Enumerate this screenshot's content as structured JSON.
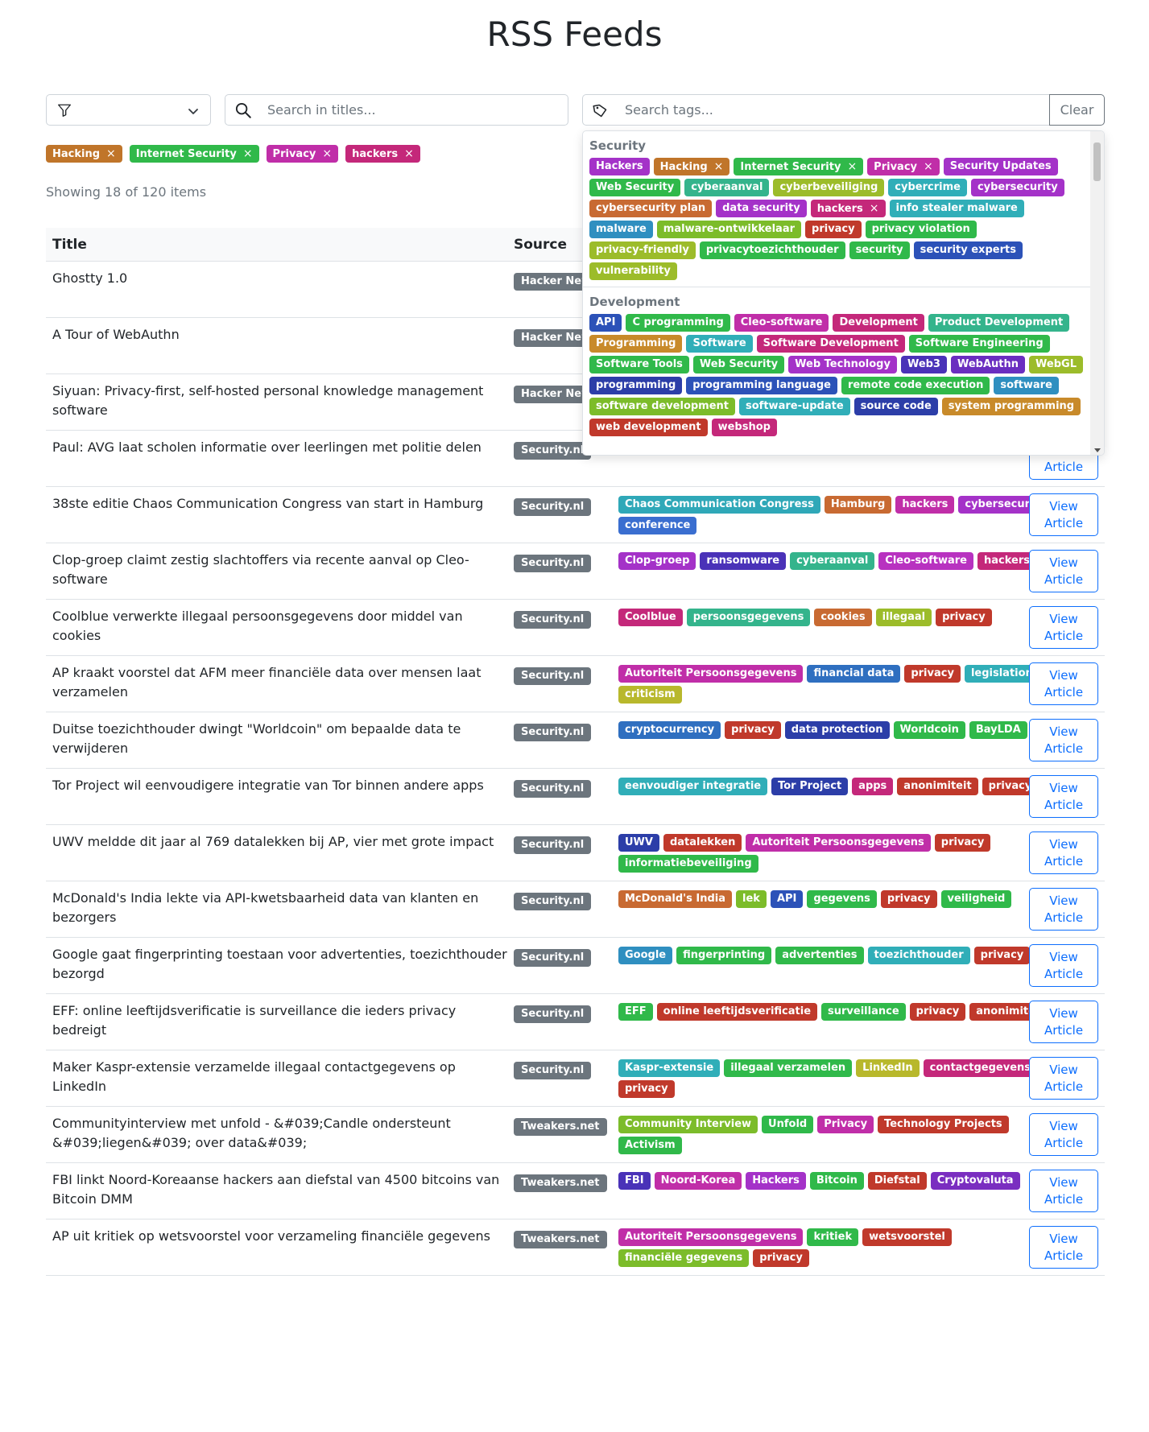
{
  "page": {
    "title": "RSS Feeds"
  },
  "filters": {
    "search_placeholder": "Search in titles...",
    "tag_search_placeholder": "Search tags...",
    "clear_label": "Clear",
    "active_tags": [
      {
        "label": "Hacking",
        "color": "#c0752a"
      },
      {
        "label": "Internet Security",
        "color": "#30b94a"
      },
      {
        "label": "Privacy",
        "color": "#c02ea8"
      },
      {
        "label": "hackers",
        "color": "#c4287a"
      }
    ],
    "remove_glyph": "×",
    "showing_text": "Showing 18 of 120 items"
  },
  "table": {
    "headers": {
      "title": "Title",
      "source": "Source"
    },
    "view_label": "View\nArticle",
    "rows": [
      {
        "title": "Ghostty 1.0",
        "source": "Hacker News",
        "tags": []
      },
      {
        "title": "A Tour of WebAuthn",
        "source": "Hacker News",
        "tags": []
      },
      {
        "title": "Siyuan: Privacy-first, self-hosted personal knowledge management software",
        "source": "Hacker News",
        "tags": []
      },
      {
        "title": "Paul: AVG laat scholen informatie over leerlingen met politie delen",
        "source": "Security.nl",
        "tags": []
      },
      {
        "title": "38ste editie Chaos Communication Congress van start in Hamburg",
        "source": "Security.nl",
        "tags": [
          {
            "label": "Chaos Communication Congress",
            "color": "#2fa8b8"
          },
          {
            "label": "Hamburg",
            "color": "#c86a32"
          },
          {
            "label": "hackers",
            "color": "#c02ea8"
          },
          {
            "label": "cybersecurity",
            "color": "#a432c8"
          },
          {
            "label": "conference",
            "color": "#3a6ed0"
          }
        ]
      },
      {
        "title": "Clop-groep claimt zestig slachtoffers via recente aanval op Cleo-software",
        "source": "Security.nl",
        "tags": [
          {
            "label": "Clop-groep",
            "color": "#a432c8"
          },
          {
            "label": "ransomware",
            "color": "#4a32b8"
          },
          {
            "label": "cyberaanval",
            "color": "#34b48c"
          },
          {
            "label": "Cleo-software",
            "color": "#b832c0"
          },
          {
            "label": "hackers",
            "color": "#c4287a"
          }
        ]
      },
      {
        "title": "Coolblue verwerkte illegaal persoonsgegevens door middel van cookies",
        "source": "Security.nl",
        "tags": [
          {
            "label": "Coolblue",
            "color": "#c4287a"
          },
          {
            "label": "persoonsgegevens",
            "color": "#34b48c"
          },
          {
            "label": "cookies",
            "color": "#c86a32"
          },
          {
            "label": "illegaal",
            "color": "#9cbc2a"
          },
          {
            "label": "privacy",
            "color": "#c0392b"
          }
        ]
      },
      {
        "title": "AP kraakt voorstel dat AFM meer financiële data over mensen laat verzamelen",
        "source": "Security.nl",
        "tags": [
          {
            "label": "Autoriteit Persoonsgegevens",
            "color": "#c02ea8"
          },
          {
            "label": "financial data",
            "color": "#2f6fc0"
          },
          {
            "label": "privacy",
            "color": "#c0392b"
          },
          {
            "label": "legislation",
            "color": "#30aeb8"
          },
          {
            "label": "criticism",
            "color": "#b8b82c"
          }
        ]
      },
      {
        "title": "Duitse toezichthouder dwingt \"Worldcoin\" om bepaalde data te verwijderen",
        "source": "Security.nl",
        "tags": [
          {
            "label": "cryptocurrency",
            "color": "#2f6fc0"
          },
          {
            "label": "privacy",
            "color": "#c0392b"
          },
          {
            "label": "data protection",
            "color": "#2c3ea8"
          },
          {
            "label": "Worldcoin",
            "color": "#30b94a"
          },
          {
            "label": "BayLDA",
            "color": "#30b94a"
          }
        ]
      },
      {
        "title": "Tor Project wil eenvoudigere integratie van Tor binnen andere apps",
        "source": "Security.nl",
        "tags": [
          {
            "label": "eenvoudiger integratie",
            "color": "#30aeb8"
          },
          {
            "label": "Tor Project",
            "color": "#2c3ea8"
          },
          {
            "label": "apps",
            "color": "#c4287a"
          },
          {
            "label": "anonimiteit",
            "color": "#c0392b"
          },
          {
            "label": "privacy",
            "color": "#c0392b"
          }
        ]
      },
      {
        "title": "UWV meldde dit jaar al 769 datalekken bij AP, vier met grote impact",
        "source": "Security.nl",
        "tags": [
          {
            "label": "UWV",
            "color": "#2c3ea8"
          },
          {
            "label": "datalekken",
            "color": "#c0392b"
          },
          {
            "label": "Autoriteit Persoonsgegevens",
            "color": "#c02ea8"
          },
          {
            "label": "privacy",
            "color": "#c0392b"
          },
          {
            "label": "informatiebeveiliging",
            "color": "#30b94a"
          }
        ]
      },
      {
        "title": "McDonald's India lekte via API-kwetsbaarheid data van klanten en bezorgers",
        "source": "Security.nl",
        "tags": [
          {
            "label": "McDonald's India",
            "color": "#c86a32"
          },
          {
            "label": "lek",
            "color": "#7cbc2a"
          },
          {
            "label": "API",
            "color": "#2c52b8"
          },
          {
            "label": "gegevens",
            "color": "#30b94a"
          },
          {
            "label": "privacy",
            "color": "#c0392b"
          },
          {
            "label": "veiligheid",
            "color": "#30b94a"
          }
        ]
      },
      {
        "title": "Google gaat fingerprinting toestaan voor advertenties, toezichthouder bezorgd",
        "source": "Security.nl",
        "tags": [
          {
            "label": "Google",
            "color": "#2f8fc0"
          },
          {
            "label": "fingerprinting",
            "color": "#30b94a"
          },
          {
            "label": "advertenties",
            "color": "#30b94a"
          },
          {
            "label": "toezichthouder",
            "color": "#30aeb8"
          },
          {
            "label": "privacy",
            "color": "#c0392b"
          }
        ]
      },
      {
        "title": "EFF: online leeftijdsverificatie is surveillance die ieders privacy bedreigt",
        "source": "Security.nl",
        "tags": [
          {
            "label": "EFF",
            "color": "#30b94a"
          },
          {
            "label": "online leeftijdsverificatie",
            "color": "#c0392b"
          },
          {
            "label": "surveillance",
            "color": "#30b94a"
          },
          {
            "label": "privacy",
            "color": "#c0392b"
          },
          {
            "label": "anonimiteit",
            "color": "#c0392b"
          }
        ]
      },
      {
        "title": "Maker Kaspr-extensie verzamelde illegaal contactgegevens op LinkedIn",
        "source": "Security.nl",
        "tags": [
          {
            "label": "Kaspr-extensie",
            "color": "#30aeb8"
          },
          {
            "label": "illegaal verzamelen",
            "color": "#30b94a"
          },
          {
            "label": "LinkedIn",
            "color": "#b8b82c"
          },
          {
            "label": "contactgegevens",
            "color": "#c4287a"
          },
          {
            "label": "privacy",
            "color": "#c0392b"
          }
        ]
      },
      {
        "title": "Communityinterview met unfold - &#039;Candle ondersteunt &#039;liegen&#039; over data&#039;",
        "source": "Tweakers.net",
        "tags": [
          {
            "label": "Community Interview",
            "color": "#7cbc2a"
          },
          {
            "label": "Unfold",
            "color": "#30b94a"
          },
          {
            "label": "Privacy",
            "color": "#c02ea8"
          },
          {
            "label": "Technology Projects",
            "color": "#c0392b"
          },
          {
            "label": "Activism",
            "color": "#30b94a"
          }
        ]
      },
      {
        "title": "FBI linkt Noord-Koreaanse hackers aan diefstal van 4500 bitcoins van Bitcoin DMM",
        "source": "Tweakers.net",
        "tags": [
          {
            "label": "FBI",
            "color": "#4a32b8"
          },
          {
            "label": "Noord-Korea",
            "color": "#c02ea8"
          },
          {
            "label": "Hackers",
            "color": "#a432c8"
          },
          {
            "label": "Bitcoin",
            "color": "#30b94a"
          },
          {
            "label": "Diefstal",
            "color": "#c0392b"
          },
          {
            "label": "Cryptovaluta",
            "color": "#7a2ec0"
          }
        ]
      },
      {
        "title": "AP uit kritiek op wetsvoorstel voor verzameling financiële gegevens",
        "source": "Tweakers.net",
        "tags": [
          {
            "label": "Autoriteit Persoonsgegevens",
            "color": "#c02ea8"
          },
          {
            "label": "kritiek",
            "color": "#30b94a"
          },
          {
            "label": "wetsvoorstel",
            "color": "#c0392b"
          },
          {
            "label": "financiële gegevens",
            "color": "#7cbc2a"
          },
          {
            "label": "privacy",
            "color": "#c0392b"
          }
        ]
      }
    ]
  },
  "dropdown": {
    "groups": [
      {
        "name": "Security",
        "tags": [
          {
            "label": "Hackers",
            "color": "#a432c8"
          },
          {
            "label": "Hacking",
            "color": "#c0752a",
            "selected": true
          },
          {
            "label": "Internet Security",
            "color": "#30b94a",
            "selected": true
          },
          {
            "label": "Privacy",
            "color": "#c02ea8",
            "selected": true
          },
          {
            "label": "Security Updates",
            "color": "#a432c8"
          },
          {
            "label": "Web Security",
            "color": "#30b94a"
          },
          {
            "label": "cyberaanval",
            "color": "#34b48c"
          },
          {
            "label": "cyberbeveiliging",
            "color": "#9cbc2a"
          },
          {
            "label": "cybercrime",
            "color": "#30aeb8"
          },
          {
            "label": "cybersecurity",
            "color": "#a432c8"
          },
          {
            "label": "cybersecurity plan",
            "color": "#c86a32"
          },
          {
            "label": "data security",
            "color": "#a432c8"
          },
          {
            "label": "hackers",
            "color": "#c4287a",
            "selected": true
          },
          {
            "label": "info stealer malware",
            "color": "#30aeb8"
          },
          {
            "label": "malware",
            "color": "#2f8fc0"
          },
          {
            "label": "malware-ontwikkelaar",
            "color": "#7cbc2a"
          },
          {
            "label": "privacy",
            "color": "#c0392b"
          },
          {
            "label": "privacy violation",
            "color": "#30b94a"
          },
          {
            "label": "privacy-friendly",
            "color": "#9cbc2a"
          },
          {
            "label": "privacytoezichthouder",
            "color": "#30b94a"
          },
          {
            "label": "security",
            "color": "#30b94a"
          },
          {
            "label": "security experts",
            "color": "#2c52b8"
          },
          {
            "label": "vulnerability",
            "color": "#9cbc2a"
          }
        ]
      },
      {
        "name": "Development",
        "tags": [
          {
            "label": "API",
            "color": "#2c52b8"
          },
          {
            "label": "C programming",
            "color": "#30b94a"
          },
          {
            "label": "Cleo-software",
            "color": "#c02ea8"
          },
          {
            "label": "Development",
            "color": "#c4287a"
          },
          {
            "label": "Product Development",
            "color": "#34b48c"
          },
          {
            "label": "Programming",
            "color": "#c88a2a"
          },
          {
            "label": "Software",
            "color": "#30aeb8"
          },
          {
            "label": "Software Development",
            "color": "#c4287a"
          },
          {
            "label": "Software Engineering",
            "color": "#30b94a"
          },
          {
            "label": "Software Tools",
            "color": "#30b94a"
          },
          {
            "label": "Web Security",
            "color": "#30b94a"
          },
          {
            "label": "Web Technology",
            "color": "#a432c8"
          },
          {
            "label": "Web3",
            "color": "#4a32b8"
          },
          {
            "label": "WebAuthn",
            "color": "#6a2ec0"
          },
          {
            "label": "WebGL",
            "color": "#9cbc2a"
          },
          {
            "label": "programming",
            "color": "#2c3ea8"
          },
          {
            "label": "programming language",
            "color": "#2c52b8"
          },
          {
            "label": "remote code execution",
            "color": "#30b94a"
          },
          {
            "label": "software",
            "color": "#2f8fc0"
          },
          {
            "label": "software development",
            "color": "#7cbc2a"
          },
          {
            "label": "software-update",
            "color": "#30aeb8"
          },
          {
            "label": "source code",
            "color": "#2c3ea8"
          },
          {
            "label": "system programming",
            "color": "#c88a2a"
          },
          {
            "label": "web development",
            "color": "#c0392b"
          },
          {
            "label": "webshop",
            "color": "#c4287a"
          }
        ]
      }
    ]
  },
  "icons": {
    "filter": "funnel-icon",
    "dropdown": "chevron-down-icon",
    "search": "search-icon",
    "tags": "tag-icon"
  }
}
